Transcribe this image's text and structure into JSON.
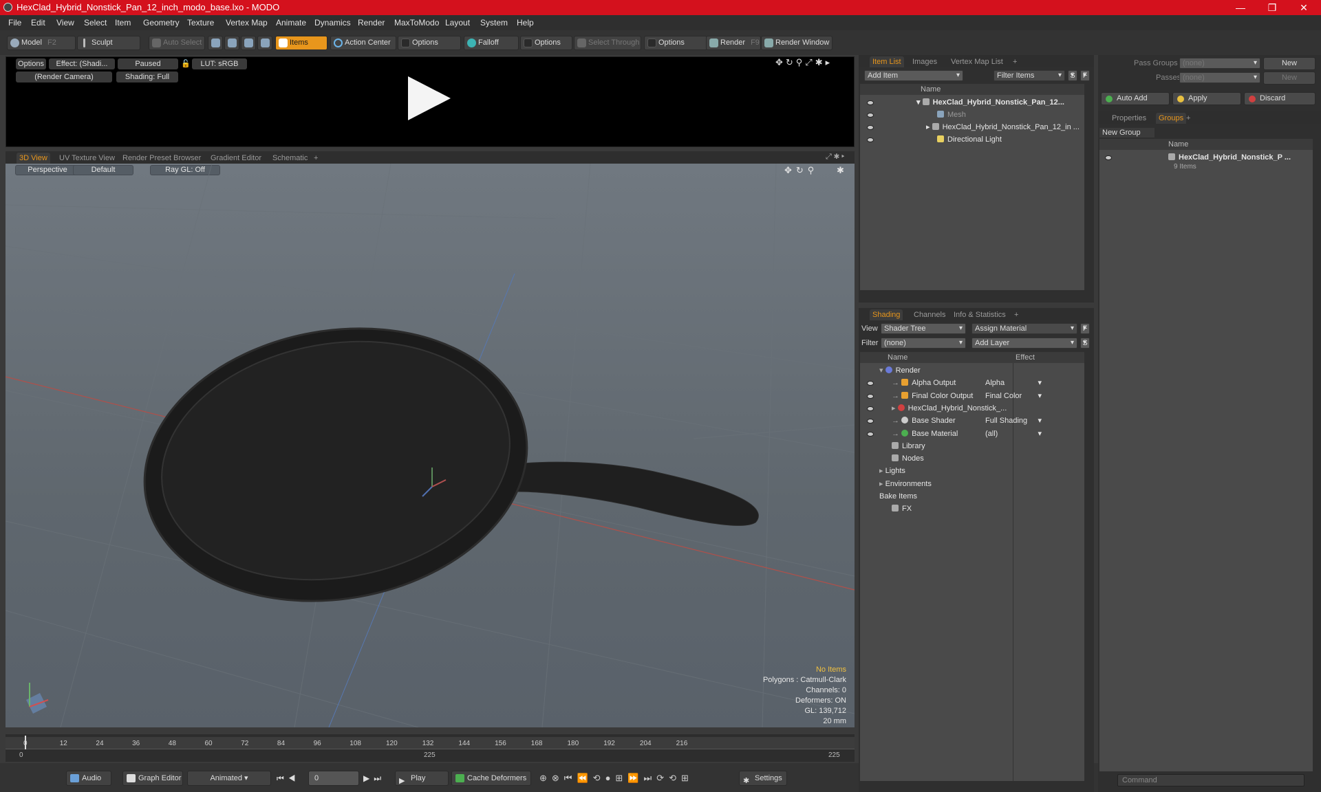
{
  "window": {
    "title": "HexClad_Hybrid_Nonstick_Pan_12_inch_modo_base.lxo - MODO",
    "minimize": "—",
    "restore": "❐",
    "close": "✕"
  },
  "menu": [
    "File",
    "Edit",
    "View",
    "Select",
    "Item",
    "Geometry",
    "Texture",
    "Vertex Map",
    "Animate",
    "Dynamics",
    "Render",
    "MaxToModo",
    "Layout",
    "System",
    "Help"
  ],
  "toolbar": {
    "model": "Model",
    "model_key": "F2",
    "sculpt": "Sculpt",
    "auto_select": "Auto Select",
    "items": "Items",
    "action_center": "Action Center",
    "options1": "Options",
    "falloff": "Falloff",
    "options2": "Options",
    "select_through": "Select Through",
    "options3": "Options",
    "render": "Render",
    "render_key": "F9",
    "render_window": "Render Window"
  },
  "preview": {
    "options": "Options",
    "effect": "Effect: (Shadi...",
    "paused": "Paused",
    "lut": "LUT: sRGB",
    "camera": "(Render Camera)",
    "shading": "Shading: Full"
  },
  "view_tabs": [
    "3D View",
    "UV Texture View",
    "Render Preset Browser",
    "Gradient Editor",
    "Schematic",
    "+"
  ],
  "viewport": {
    "perspective": "Perspective",
    "default": "Default",
    "raygl": "Ray GL: Off",
    "no_items": "No Items",
    "polygons": "Polygons : Catmull-Clark",
    "channels": "Channels: 0",
    "deformers": "Deformers: ON",
    "gl": "GL: 139,712",
    "unit": "20 mm"
  },
  "timeline": {
    "ticks": [
      "0",
      "12",
      "24",
      "36",
      "48",
      "60",
      "72",
      "84",
      "96",
      "108",
      "120",
      "132",
      "144",
      "156",
      "168",
      "180",
      "192",
      "204",
      "216"
    ],
    "start": "0",
    "mid": "225",
    "end": "225"
  },
  "bottom": {
    "audio": "Audio",
    "graph_editor": "Graph Editor",
    "animated": "Animated",
    "frame": "0",
    "play": "Play",
    "cache": "Cache Deformers",
    "settings": "Settings"
  },
  "item_list": {
    "tabs": [
      "Item List",
      "Images",
      "Vertex Map List",
      "+"
    ],
    "add_item": "Add Item",
    "filter": "Filter Items",
    "s": "S",
    "f": "F",
    "col_name": "Name",
    "rows": [
      {
        "label": "HexClad_Hybrid_Nonstick_Pan_12..."
      },
      {
        "label": "Mesh"
      },
      {
        "label": "HexClad_Hybrid_Nonstick_Pan_12_in ..."
      },
      {
        "label": "Directional Light"
      }
    ]
  },
  "shading": {
    "tabs": [
      "Shading",
      "Channels",
      "Info & Statistics",
      "+"
    ],
    "view_label": "View",
    "view_value": "Shader Tree",
    "assign": "Assign Material",
    "f": "F",
    "filter_label": "Filter",
    "filter_value": "(none)",
    "add_layer": "Add Layer",
    "s": "S",
    "col_name": "Name",
    "col_effect": "Effect",
    "rows": [
      {
        "name": "Render",
        "effect": ""
      },
      {
        "name": "Alpha Output",
        "effect": "Alpha"
      },
      {
        "name": "Final Color Output",
        "effect": "Final Color"
      },
      {
        "name": "HexClad_Hybrid_Nonstick_...",
        "effect": ""
      },
      {
        "name": "Base Shader",
        "effect": "Full Shading"
      },
      {
        "name": "Base Material",
        "effect": "(all)"
      },
      {
        "name": "Library",
        "effect": ""
      },
      {
        "name": "Nodes",
        "effect": ""
      },
      {
        "name": "Lights",
        "effect": ""
      },
      {
        "name": "Environments",
        "effect": ""
      },
      {
        "name": "Bake Items",
        "effect": ""
      },
      {
        "name": "FX",
        "effect": ""
      }
    ]
  },
  "groups": {
    "pass_groups": "Pass Groups",
    "passes": "Passes",
    "none1": "(none)",
    "none2": "(none)",
    "new1": "New",
    "new2": "New",
    "auto_add": "Auto Add",
    "apply": "Apply",
    "discard": "Discard",
    "tabs": [
      "Properties",
      "Groups",
      "+"
    ],
    "new_group": "New Group",
    "col_name": "Name",
    "item": "HexClad_Hybrid_Nonstick_P ...",
    "item_count": "9 Items"
  },
  "command": {
    "placeholder": "Command"
  }
}
